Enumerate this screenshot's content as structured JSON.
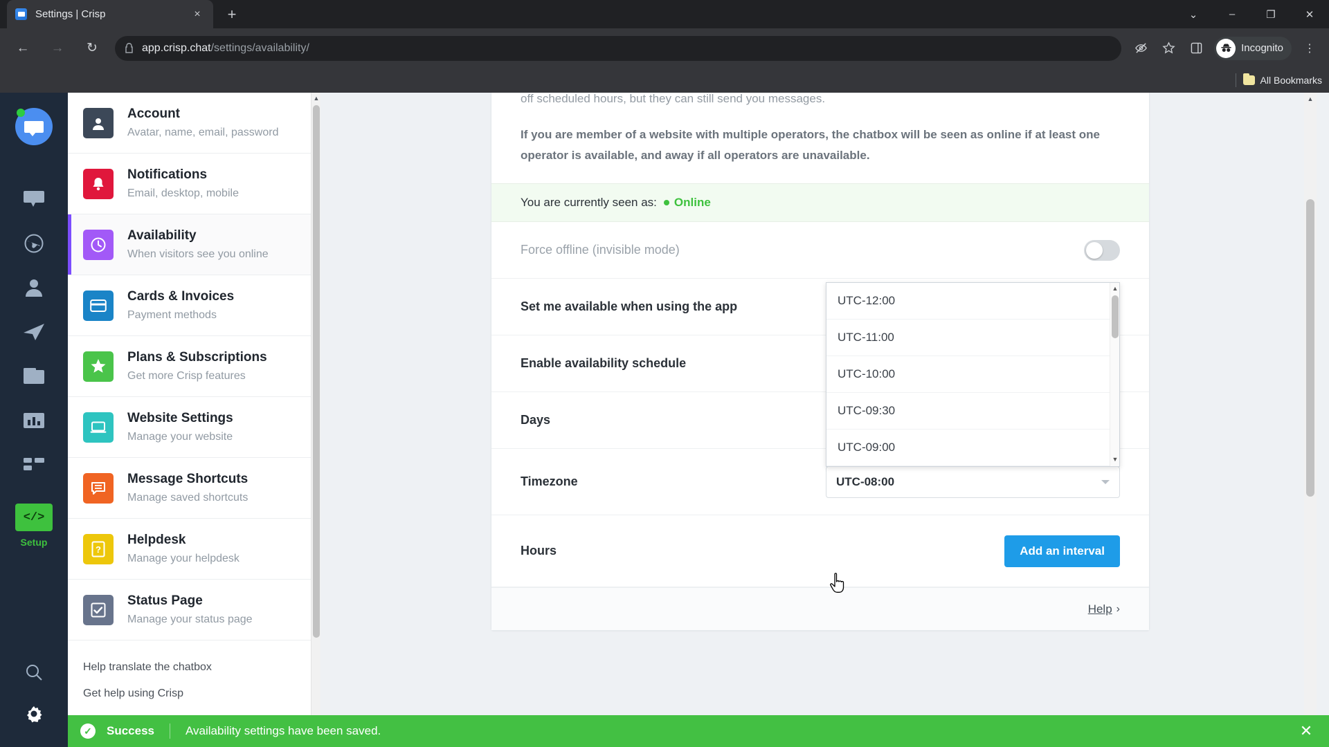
{
  "browser": {
    "tab": {
      "title": "Settings | Crisp",
      "favicon": "crisp-chat-icon",
      "close": "×"
    },
    "new_tab_label": "+",
    "window_controls": {
      "minimize": "–",
      "maximize": "❐",
      "close": "✕",
      "tab_search": "⌄"
    },
    "nav": {
      "back": "←",
      "forward": "→",
      "reload": "↻"
    },
    "url": {
      "secure_domain": "app.crisp.chat",
      "path": "/settings/availability/",
      "lock": "lock-icon"
    },
    "omnibox_right": {
      "privacy": "eye-off-icon",
      "bookmark": "star-icon",
      "side_panel": "side-panel-icon",
      "menu": "⋮"
    },
    "profile": {
      "label": "Incognito",
      "icon": "incognito-icon"
    },
    "bookmarks": {
      "all_bookmarks": "All Bookmarks"
    }
  },
  "rail": {
    "logo": "crisp-logo",
    "items": [
      {
        "name": "inbox",
        "icon": "chat-bubble-icon"
      },
      {
        "name": "visitors",
        "icon": "globe-icon"
      },
      {
        "name": "contacts",
        "icon": "person-icon"
      },
      {
        "name": "campaigns",
        "icon": "paper-plane-icon"
      },
      {
        "name": "helpdesk",
        "icon": "book-icon"
      },
      {
        "name": "analytics",
        "icon": "bar-chart-icon"
      },
      {
        "name": "plugins",
        "icon": "grid-icon"
      }
    ],
    "setup": {
      "label": "Setup",
      "icon": "code-brackets-icon"
    },
    "bottom": [
      {
        "name": "search",
        "icon": "magnifier-icon"
      },
      {
        "name": "settings",
        "icon": "gear-icon"
      }
    ]
  },
  "settings_nav": {
    "items": [
      {
        "title": "Account",
        "subtitle": "Avatar, name, email, password",
        "icon": "person-card-icon",
        "color": "#3c4858",
        "active": false
      },
      {
        "title": "Notifications",
        "subtitle": "Email, desktop, mobile",
        "icon": "bell-icon",
        "color": "#e0173c",
        "active": false
      },
      {
        "title": "Availability",
        "subtitle": "When visitors see you online",
        "icon": "clock-icon",
        "color": "#a259f7",
        "active": true
      },
      {
        "title": "Cards & Invoices",
        "subtitle": "Payment methods",
        "icon": "credit-card-icon",
        "color": "#1a84c7",
        "active": false
      },
      {
        "title": "Plans & Subscriptions",
        "subtitle": "Get more Crisp features",
        "icon": "star-icon",
        "color": "#4ac44a",
        "active": false
      },
      {
        "title": "Website Settings",
        "subtitle": "Manage your website",
        "icon": "laptop-icon",
        "color": "#2ec4c0",
        "active": false
      },
      {
        "title": "Message Shortcuts",
        "subtitle": "Manage saved shortcuts",
        "icon": "message-lines-icon",
        "color": "#f06423",
        "active": false
      },
      {
        "title": "Helpdesk",
        "subtitle": "Manage your helpdesk",
        "icon": "question-doc-icon",
        "color": "#edc70b",
        "active": false
      },
      {
        "title": "Status Page",
        "subtitle": "Manage your status page",
        "icon": "check-square-icon",
        "color": "#68748c",
        "active": false
      }
    ],
    "footer_links": [
      "Help translate the chatbox",
      "Get help using Crisp"
    ]
  },
  "main": {
    "intro_line_1": "off scheduled hours, but they can still send you messages.",
    "intro_line_2": "If you are member of a website with multiple operators, the chatbox will be seen as online if at least one operator is available, and away if all operators are unavailable.",
    "status": {
      "label": "You are currently seen as:",
      "value": "Online",
      "color": "#3ec13e"
    },
    "rows": {
      "force_offline": {
        "label": "Force offline (invisible mode)",
        "toggle": "off"
      },
      "set_available": {
        "label": "Set me available when using the app",
        "toggle": "on"
      },
      "enable_schedule": {
        "label": "Enable availability schedule",
        "toggle": "on"
      },
      "days": {
        "label": "Days"
      },
      "timezone": {
        "label": "Timezone",
        "selected": "UTC-08:00"
      },
      "hours": {
        "label": "Hours",
        "button": "Add an interval"
      }
    },
    "timezone_dropdown": {
      "open": true,
      "options": [
        "UTC-12:00",
        "UTC-11:00",
        "UTC-10:00",
        "UTC-09:30",
        "UTC-09:00"
      ]
    },
    "footer": {
      "help": "Help",
      "chevron": "›"
    }
  },
  "toast": {
    "title": "Success",
    "message": "Availability settings have been saved.",
    "close": "✕",
    "color": "#43c043"
  }
}
